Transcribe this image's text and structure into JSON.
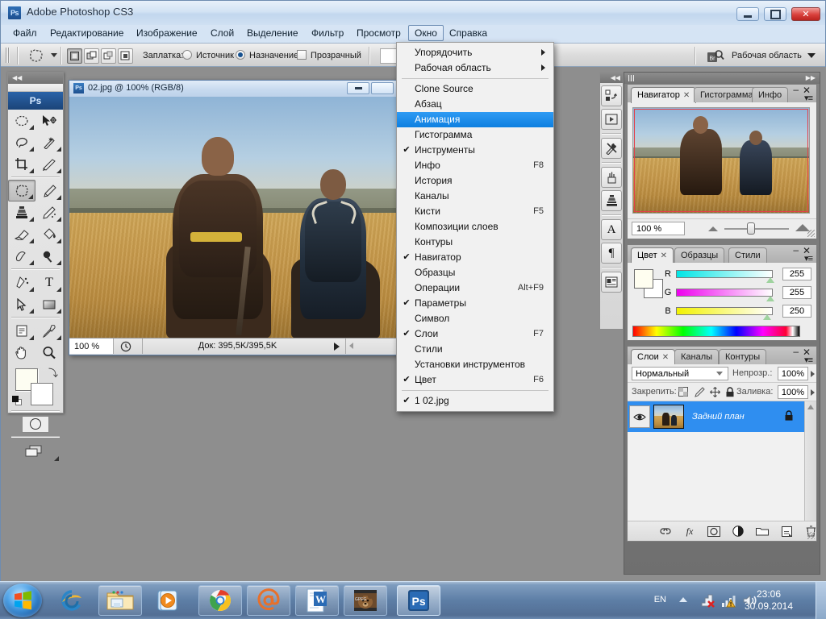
{
  "window": {
    "app_title": "Adobe Photoshop CS3",
    "logo_text": "Ps",
    "minimize_label": "Свернуть",
    "maximize_label": "Развернуть",
    "close_label": "✕"
  },
  "menubar": {
    "items": [
      {
        "label": "Файл",
        "active": false
      },
      {
        "label": "Редактирование",
        "active": false
      },
      {
        "label": "Изображение",
        "active": false
      },
      {
        "label": "Слой",
        "active": false
      },
      {
        "label": "Выделение",
        "active": false
      },
      {
        "label": "Фильтр",
        "active": false
      },
      {
        "label": "Просмотр",
        "active": false
      },
      {
        "label": "Окно",
        "active": true
      },
      {
        "label": "Справка",
        "active": false
      }
    ]
  },
  "options_bar": {
    "tool_name": "Заплатка:",
    "patch_label": "Заплатка:",
    "source_label": "Источник",
    "destination_label": "Назначение",
    "transparent_label": "Прозрачный",
    "source_selected": false,
    "destination_selected": true,
    "transparent_checked": false,
    "workspace_label": "Рабочая область",
    "bridge_icon": "bridge-icon"
  },
  "dropdown_menu": {
    "title": "Окно",
    "items": [
      {
        "label": "Упорядочить",
        "checked": false,
        "accel": "",
        "submenu": true,
        "highlighted": false
      },
      {
        "label": "Рабочая область",
        "checked": false,
        "accel": "",
        "submenu": true,
        "highlighted": false
      },
      {
        "separator": true
      },
      {
        "label": "Clone Source",
        "checked": false,
        "accel": "",
        "submenu": false,
        "highlighted": false
      },
      {
        "label": "Абзац",
        "checked": false,
        "accel": "",
        "submenu": false,
        "highlighted": false
      },
      {
        "label": "Анимация",
        "checked": false,
        "accel": "",
        "submenu": false,
        "highlighted": true
      },
      {
        "label": "Гистограмма",
        "checked": false,
        "accel": "",
        "submenu": false,
        "highlighted": false
      },
      {
        "label": "Инструменты",
        "checked": true,
        "accel": "",
        "submenu": false,
        "highlighted": false
      },
      {
        "label": "Инфо",
        "checked": false,
        "accel": "F8",
        "submenu": false,
        "highlighted": false
      },
      {
        "label": "История",
        "checked": false,
        "accel": "",
        "submenu": false,
        "highlighted": false
      },
      {
        "label": "Каналы",
        "checked": false,
        "accel": "",
        "submenu": false,
        "highlighted": false
      },
      {
        "label": "Кисти",
        "checked": false,
        "accel": "F5",
        "submenu": false,
        "highlighted": false
      },
      {
        "label": "Композиции слоев",
        "checked": false,
        "accel": "",
        "submenu": false,
        "highlighted": false
      },
      {
        "label": "Контуры",
        "checked": false,
        "accel": "",
        "submenu": false,
        "highlighted": false
      },
      {
        "label": "Навигатор",
        "checked": true,
        "accel": "",
        "submenu": false,
        "highlighted": false
      },
      {
        "label": "Образцы",
        "checked": false,
        "accel": "",
        "submenu": false,
        "highlighted": false
      },
      {
        "label": "Операции",
        "checked": false,
        "accel": "Alt+F9",
        "submenu": false,
        "highlighted": false
      },
      {
        "label": "Параметры",
        "checked": true,
        "accel": "",
        "submenu": false,
        "highlighted": false
      },
      {
        "label": "Символ",
        "checked": false,
        "accel": "",
        "submenu": false,
        "highlighted": false
      },
      {
        "label": "Слои",
        "checked": true,
        "accel": "F7",
        "submenu": false,
        "highlighted": false
      },
      {
        "label": "Стили",
        "checked": false,
        "accel": "",
        "submenu": false,
        "highlighted": false
      },
      {
        "label": "Установки инструментов",
        "checked": false,
        "accel": "",
        "submenu": false,
        "highlighted": false
      },
      {
        "label": "Цвет",
        "checked": true,
        "accel": "F6",
        "submenu": false,
        "highlighted": false
      },
      {
        "separator": true
      },
      {
        "label": "1 02.jpg",
        "checked": true,
        "accel": "",
        "submenu": false,
        "highlighted": false
      }
    ]
  },
  "toolbox": {
    "logo": "Ps",
    "tools": [
      {
        "name": "marquee-tool",
        "glyph": "ellipse"
      },
      {
        "name": "move-tool",
        "glyph": "move"
      },
      {
        "name": "lasso-tool",
        "glyph": "lasso"
      },
      {
        "name": "magic-wand-tool",
        "glyph": "wand"
      },
      {
        "name": "crop-tool",
        "glyph": "crop"
      },
      {
        "name": "slice-tool",
        "glyph": "slice"
      },
      {
        "name": "patch-tool",
        "glyph": "patch",
        "selected": true
      },
      {
        "name": "brush-tool",
        "glyph": "brush"
      },
      {
        "name": "clone-stamp-tool",
        "glyph": "stamp"
      },
      {
        "name": "history-brush-tool",
        "glyph": "history-brush"
      },
      {
        "name": "eraser-tool",
        "glyph": "eraser"
      },
      {
        "name": "gradient-tool",
        "glyph": "paint-bucket"
      },
      {
        "name": "blur-tool",
        "glyph": "blur"
      },
      {
        "name": "dodge-tool",
        "glyph": "dodge"
      },
      {
        "name": "pen-tool",
        "glyph": "pen"
      },
      {
        "name": "type-tool",
        "glyph": "T"
      },
      {
        "name": "path-selection-tool",
        "glyph": "arrow"
      },
      {
        "name": "shape-tool",
        "glyph": "rect"
      },
      {
        "name": "notes-tool",
        "glyph": "note"
      },
      {
        "name": "eyedropper-tool",
        "glyph": "eyedropper"
      },
      {
        "name": "hand-tool",
        "glyph": "hand"
      },
      {
        "name": "zoom-tool",
        "glyph": "magnifier"
      }
    ],
    "foreground_color": "#fffef0",
    "background_color": "#ffffff"
  },
  "document": {
    "title": "02.jpg @ 100% (RGB/8)",
    "zoom": "100 %",
    "doc_size": "Док: 395,5K/395,5K",
    "icon": "photoshop-document-icon"
  },
  "panels": {
    "navigator": {
      "tabs": [
        "Навигатор",
        "Гистограмма",
        "Инфо"
      ],
      "active_tab": "Навигатор",
      "zoom_value": "100 %"
    },
    "color": {
      "tabs": [
        "Цвет",
        "Образцы",
        "Стили"
      ],
      "active_tab": "Цвет",
      "channels": [
        {
          "label": "R",
          "value": "255",
          "gradient_from": "#00ffff",
          "gradient_to": "#ffffff"
        },
        {
          "label": "G",
          "value": "255",
          "gradient_from": "#ff00ff",
          "gradient_to": "#ffffff"
        },
        {
          "label": "B",
          "value": "250",
          "gradient_from": "#ffff00",
          "gradient_to": "#ffffff"
        }
      ]
    },
    "layers": {
      "tabs": [
        "Слои",
        "Каналы",
        "Контуры"
      ],
      "active_tab": "Слои",
      "blend_mode": "Нормальный",
      "opacity_label": "Непрозр.:",
      "opacity_value": "100%",
      "lock_label": "Закрепить:",
      "fill_label": "Заливка:",
      "fill_value": "100%",
      "rows": [
        {
          "name": "Задний план",
          "locked": true,
          "visible": true,
          "selected": true
        }
      ],
      "bottom_icons": [
        "link-icon",
        "fx-icon",
        "mask-icon",
        "adjustment-icon",
        "folder-icon",
        "new-layer-icon",
        "delete-icon"
      ]
    }
  },
  "icon_dock": {
    "buttons": [
      "history-icon",
      "actions-icon",
      "tool-presets-icon",
      "brushes-icon",
      "clone-source-icon",
      "character-icon",
      "paragraph-icon",
      "layer-comps-icon"
    ]
  },
  "taskbar": {
    "start_label": "Пуск",
    "items": [
      {
        "name": "internet-explorer-icon",
        "active": false,
        "boxed": false
      },
      {
        "name": "explorer-folder-icon",
        "active": false,
        "boxed": true
      },
      {
        "name": "media-player-icon",
        "active": false,
        "boxed": false
      },
      {
        "name": "chrome-icon",
        "active": false,
        "boxed": true
      },
      {
        "name": "mail-at-icon",
        "active": false,
        "boxed": true
      },
      {
        "name": "word-icon",
        "active": false,
        "boxed": true
      },
      {
        "name": "bear-photo-icon",
        "active": false,
        "boxed": true
      },
      {
        "name": "photoshop-icon",
        "active": true,
        "boxed": true
      }
    ],
    "tray": {
      "language": "EN",
      "time": "23:06",
      "date": "30.09.2014",
      "icons": [
        "network-error-icon",
        "signal-warning-icon",
        "volume-icon"
      ]
    }
  }
}
